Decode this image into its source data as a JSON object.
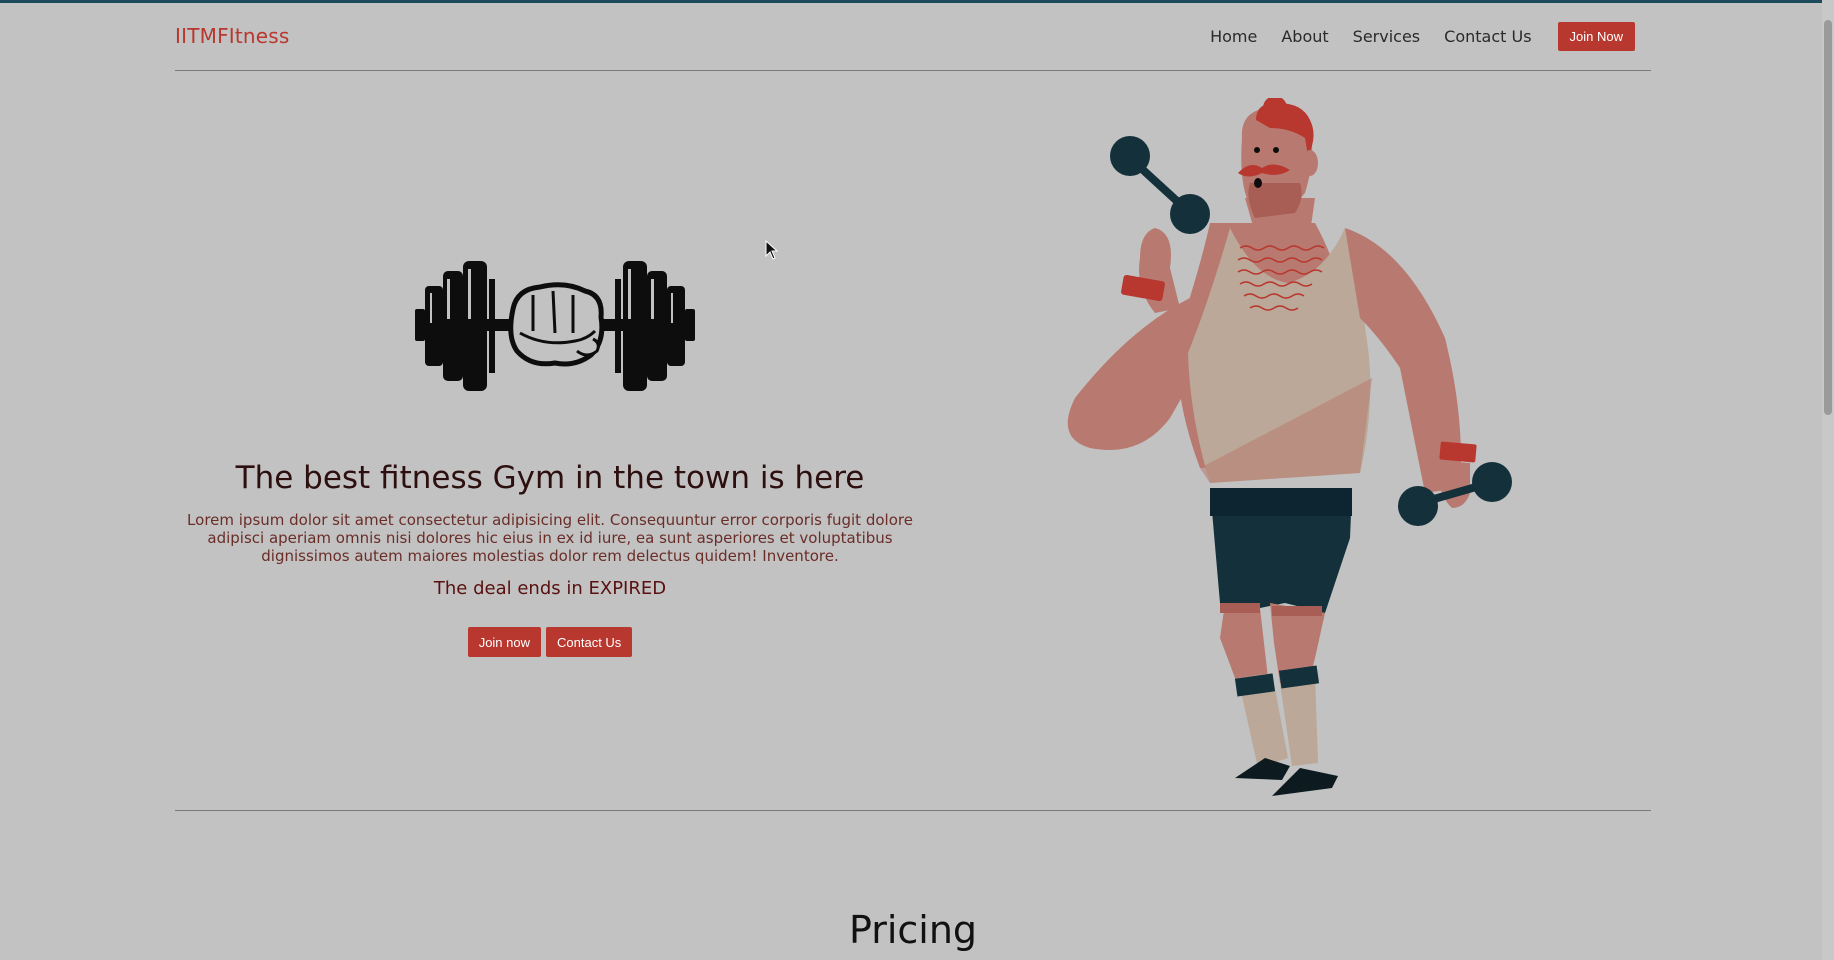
{
  "navbar": {
    "brand": "IITMFItness",
    "links": [
      "Home",
      "About",
      "Services",
      "Contact Us"
    ],
    "cta_label": "Join Now"
  },
  "hero": {
    "title": "The best fitness Gym in the town is here",
    "description": "Lorem ipsum dolor sit amet consectetur adipisicing elit. Consequuntur error corporis fugit dolore adipisci aperiam omnis nisi dolores hic eius in ex id iure, ea sunt asperiores et voluptatibus dignissimos autem maiores molestias dolor rem delectus quidem! Inventore.",
    "deal_prefix": "The deal ends in",
    "deal_status": "EXPIRED",
    "join_label": "Join now",
    "contact_label": "Contact Us"
  },
  "pricing": {
    "title": "Pricing"
  },
  "colors": {
    "accent": "#b8372e",
    "background": "#c2c2c2",
    "dark_teal": "#13303b"
  }
}
